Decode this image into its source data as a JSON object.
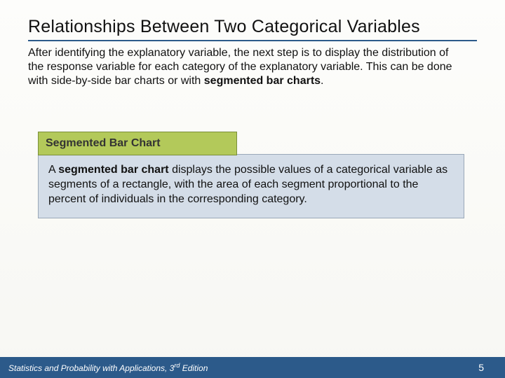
{
  "title": "Relationships Between Two Categorical Variables",
  "intro_pre": "After identifying the explanatory variable, the next step is to display the distribution of the response variable for each category of the explanatory variable. This can be done with side-by-side bar charts or with ",
  "intro_bold": "segmented bar charts",
  "intro_post": ".",
  "callout": {
    "header": "Segmented Bar Chart",
    "body_pre": "A ",
    "body_bold": "segmented bar chart",
    "body_post": " displays the possible values of a categorical variable as segments of a rectangle, with the area of each segment proportional to the percent of individuals in the corresponding category."
  },
  "footer": {
    "book_pre": "Statistics and Probability with Applications, 3",
    "book_sup": "rd",
    "book_post": " Edition",
    "page": "5"
  }
}
